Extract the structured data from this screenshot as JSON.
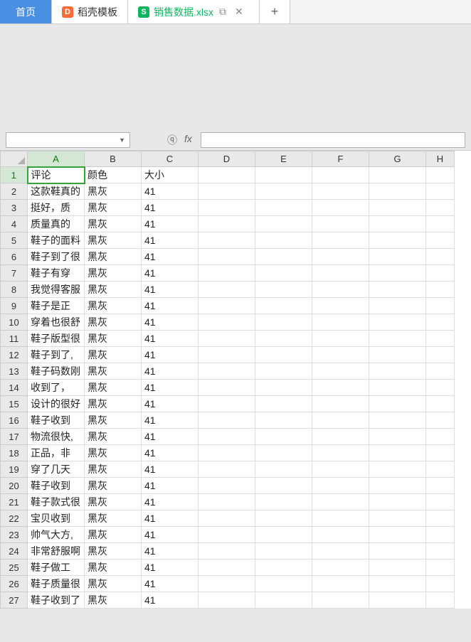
{
  "tabs": {
    "home": "首页",
    "template": "稻壳模板",
    "file": "销售数据.xlsx"
  },
  "formula_bar": {
    "name_box": " ",
    "formula": ""
  },
  "icons": {
    "zoom": "⍰",
    "fx": "fx",
    "window": "⧉",
    "close": "✕",
    "plus": "+"
  },
  "columns": [
    "A",
    "B",
    "C",
    "D",
    "E",
    "F",
    "G",
    "H"
  ],
  "selected_cell": "A1",
  "chart_data": {
    "type": "table",
    "headers": [
      "评论",
      "颜色",
      "大小"
    ],
    "rows": [
      [
        "这款鞋真的",
        "黑灰",
        "41"
      ],
      [
        "挺好，质",
        "黑灰",
        "41"
      ],
      [
        "质量真的",
        "黑灰",
        "41"
      ],
      [
        "鞋子的面料",
        "黑灰",
        "41"
      ],
      [
        "鞋子到了很",
        "黑灰",
        "41"
      ],
      [
        "鞋子有穿",
        "黑灰",
        "41"
      ],
      [
        "我觉得客服",
        "黑灰",
        "41"
      ],
      [
        "鞋子是正",
        "黑灰",
        "41"
      ],
      [
        "穿着也很舒",
        "黑灰",
        "41"
      ],
      [
        "鞋子版型很",
        "黑灰",
        "41"
      ],
      [
        "鞋子到了,",
        "黑灰",
        "41"
      ],
      [
        "鞋子码数刚",
        "黑灰",
        "41"
      ],
      [
        "收到了，",
        "黑灰",
        "41"
      ],
      [
        "设计的很好",
        "黑灰",
        "41"
      ],
      [
        "鞋子收到",
        "黑灰",
        "41"
      ],
      [
        "物流很快,",
        "黑灰",
        "41"
      ],
      [
        "正品，非",
        "黑灰",
        "41"
      ],
      [
        "穿了几天",
        "黑灰",
        "41"
      ],
      [
        "鞋子收到",
        "黑灰",
        "41"
      ],
      [
        "鞋子款式很",
        "黑灰",
        "41"
      ],
      [
        "宝贝收到",
        "黑灰",
        "41"
      ],
      [
        "帅气大方,",
        "黑灰",
        "41"
      ],
      [
        "非常舒服啊",
        "黑灰",
        "41"
      ],
      [
        "鞋子做工",
        "黑灰",
        "41"
      ],
      [
        "鞋子质量很",
        "黑灰",
        "41"
      ],
      [
        "鞋子收到了",
        "黑灰",
        "41"
      ]
    ]
  }
}
